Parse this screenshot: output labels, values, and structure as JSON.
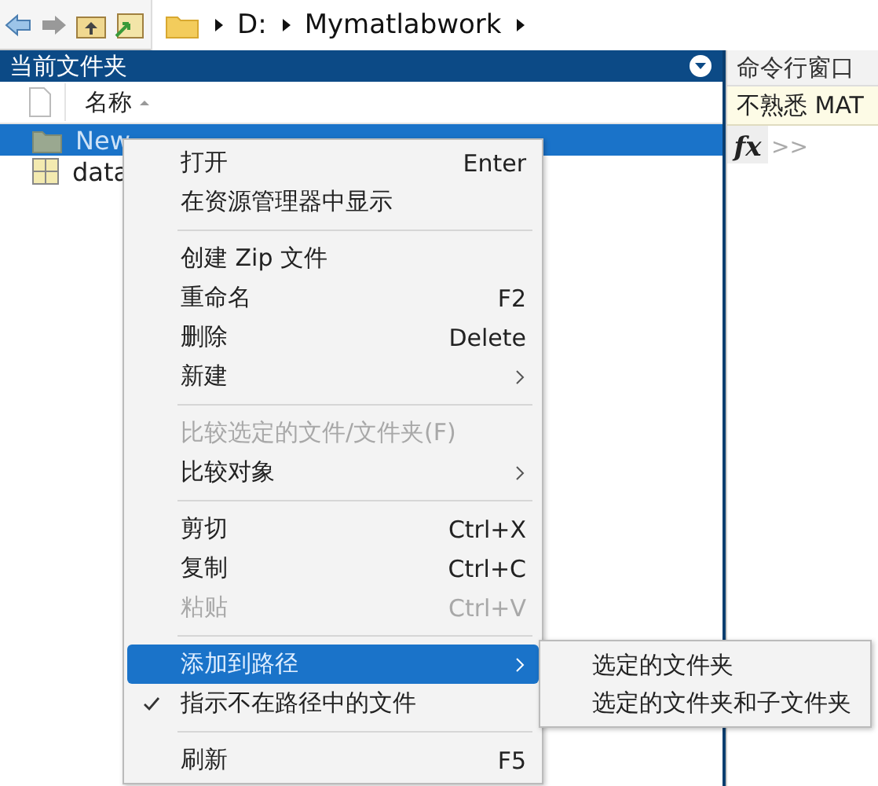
{
  "toolbar": {
    "path": [
      "D:",
      "Mymatlabwork"
    ]
  },
  "folder_panel": {
    "title": "当前文件夹",
    "columns": [
      "名称"
    ],
    "files": [
      {
        "name": "New",
        "kind": "folder",
        "selected": true
      },
      {
        "name": "data",
        "kind": "table",
        "selected": false
      }
    ]
  },
  "command_panel": {
    "title": "命令行窗口",
    "notice": "不熟悉 MAT",
    "function_label": "fx",
    "prompt": ">>"
  },
  "context_menu": {
    "items": [
      {
        "kind": "item",
        "label": "打开",
        "shortcut": "Enter",
        "disabled": false,
        "selected": false
      },
      {
        "kind": "item",
        "label": "在资源管理器中显示",
        "disabled": false,
        "selected": false
      },
      {
        "kind": "separator"
      },
      {
        "kind": "item",
        "label": "创建 Zip 文件",
        "disabled": false,
        "selected": false
      },
      {
        "kind": "item",
        "label": "重命名",
        "shortcut": "F2",
        "disabled": false,
        "selected": false
      },
      {
        "kind": "item",
        "label": "删除",
        "shortcut": "Delete",
        "disabled": false,
        "selected": false
      },
      {
        "kind": "submenu",
        "label": "新建",
        "disabled": false,
        "selected": false
      },
      {
        "kind": "separator"
      },
      {
        "kind": "item",
        "label": "比较选定的文件/文件夹(F)",
        "disabled": true,
        "selected": false
      },
      {
        "kind": "submenu",
        "label": "比较对象",
        "disabled": false,
        "selected": false
      },
      {
        "kind": "separator"
      },
      {
        "kind": "item",
        "label": "剪切",
        "shortcut": "Ctrl+X",
        "disabled": false,
        "selected": false
      },
      {
        "kind": "item",
        "label": "复制",
        "shortcut": "Ctrl+C",
        "disabled": false,
        "selected": false
      },
      {
        "kind": "item",
        "label": "粘贴",
        "shortcut": "Ctrl+V",
        "disabled": true,
        "selected": false
      },
      {
        "kind": "separator"
      },
      {
        "kind": "submenu",
        "label": "添加到路径",
        "disabled": false,
        "selected": true
      },
      {
        "kind": "item",
        "label": "指示不在路径中的文件",
        "checked": true,
        "disabled": false,
        "selected": false
      },
      {
        "kind": "separator"
      },
      {
        "kind": "item",
        "label": "刷新",
        "shortcut": "F5",
        "disabled": false,
        "selected": false
      }
    ],
    "submenu": [
      "选定的文件夹",
      "选定的文件夹和子文件夹"
    ]
  }
}
